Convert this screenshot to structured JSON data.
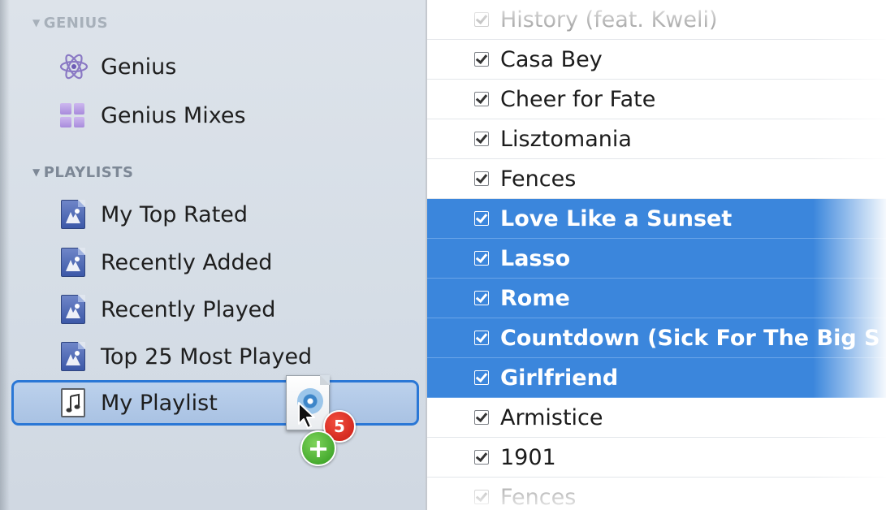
{
  "sidebar": {
    "genius_header": "GENIUS",
    "genius_items": [
      {
        "label": "Genius",
        "icon": "genius-atom-icon"
      },
      {
        "label": "Genius Mixes",
        "icon": "genius-mixes-icon"
      }
    ],
    "playlists_header": "PLAYLISTS",
    "playlist_items": [
      {
        "label": "My Top Rated",
        "icon": "smart-playlist-icon"
      },
      {
        "label": "Recently Added",
        "icon": "smart-playlist-icon"
      },
      {
        "label": "Recently Played",
        "icon": "smart-playlist-icon"
      },
      {
        "label": "Top 25 Most Played",
        "icon": "smart-playlist-icon"
      },
      {
        "label": "My Playlist",
        "icon": "playlist-icon",
        "state": "drop-target"
      }
    ]
  },
  "drag": {
    "count_badge": "5",
    "add_badge": "+"
  },
  "tracks": [
    {
      "title": "History (feat. Kweli)",
      "checked": true,
      "state": "faded"
    },
    {
      "title": "Casa Bey",
      "checked": true,
      "state": "normal"
    },
    {
      "title": "Cheer for Fate",
      "checked": true,
      "state": "normal"
    },
    {
      "title": "Lisztomania",
      "checked": true,
      "state": "normal"
    },
    {
      "title": "Fences",
      "checked": true,
      "state": "normal"
    },
    {
      "title": "Love Like a Sunset",
      "checked": true,
      "state": "selected"
    },
    {
      "title": "Lasso",
      "checked": true,
      "state": "selected"
    },
    {
      "title": "Rome",
      "checked": true,
      "state": "selected"
    },
    {
      "title": "Countdown (Sick For The Big S",
      "checked": true,
      "state": "selected"
    },
    {
      "title": "Girlfriend",
      "checked": true,
      "state": "selected"
    },
    {
      "title": "Armistice",
      "checked": true,
      "state": "normal"
    },
    {
      "title": "1901",
      "checked": true,
      "state": "normal"
    },
    {
      "title": "Fences",
      "checked": true,
      "state": "faded"
    }
  ],
  "colors": {
    "selection": "#3b86dc",
    "sidebar_bg": "#d8dfe7",
    "drop_target_border": "#2a77d6"
  }
}
